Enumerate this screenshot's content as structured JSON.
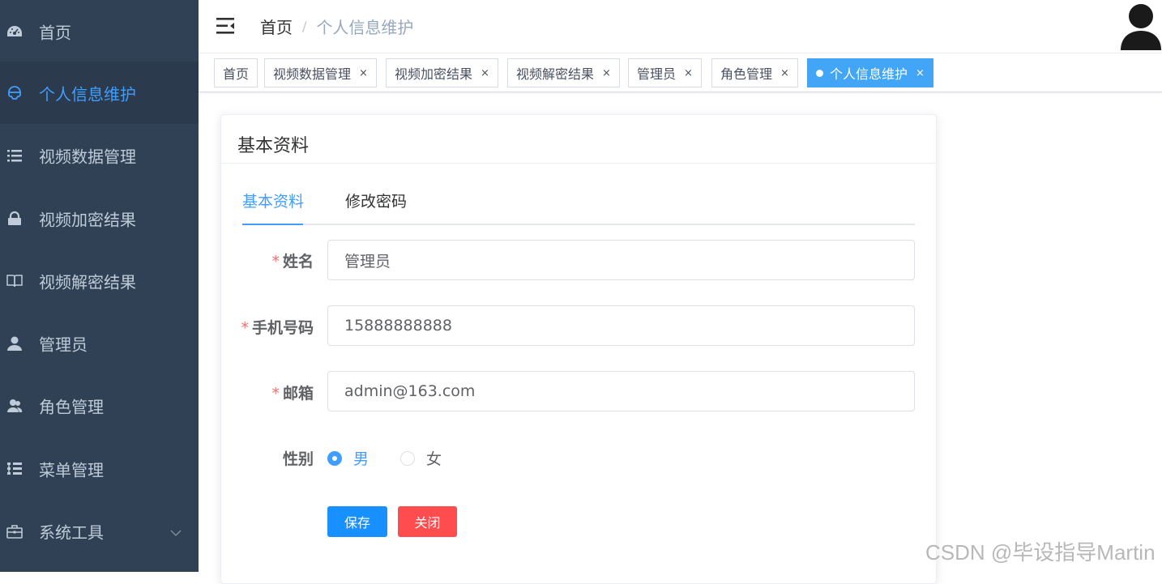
{
  "sidebar": {
    "items": [
      {
        "label": "首页",
        "icon": "dashboard-icon"
      },
      {
        "label": "个人信息维护",
        "icon": "user-profile-icon",
        "active": true
      },
      {
        "label": "视频数据管理",
        "icon": "list-icon"
      },
      {
        "label": "视频加密结果",
        "icon": "lock-icon"
      },
      {
        "label": "视频解密结果",
        "icon": "book-icon"
      },
      {
        "label": "管理员",
        "icon": "user-icon"
      },
      {
        "label": "角色管理",
        "icon": "peoples-icon"
      },
      {
        "label": "菜单管理",
        "icon": "tree-table-icon"
      },
      {
        "label": "系统工具",
        "icon": "toolbox-icon",
        "expandable": true
      }
    ]
  },
  "navbar": {
    "breadcrumb_home": "首页",
    "breadcrumb_separator": "/",
    "breadcrumb_current": "个人信息维护"
  },
  "tags": [
    {
      "label": "首页",
      "closable": false
    },
    {
      "label": "视频数据管理",
      "closable": true
    },
    {
      "label": "视频加密结果",
      "closable": true
    },
    {
      "label": "视频解密结果",
      "closable": true
    },
    {
      "label": "管理员",
      "closable": true
    },
    {
      "label": "角色管理",
      "closable": true
    },
    {
      "label": "个人信息维护",
      "closable": true,
      "active": true
    }
  ],
  "tag_close_glyph": "×",
  "card": {
    "title": "基本资料",
    "tabs": [
      {
        "label": "基本资料",
        "active": true
      },
      {
        "label": "修改密码",
        "active": false
      }
    ]
  },
  "form": {
    "required_mark": "*",
    "name_label": "姓名",
    "name_value": "管理员",
    "phone_label": "手机号码",
    "phone_value": "15888888888",
    "email_label": "邮箱",
    "email_value": "admin@163.com",
    "gender_label": "性别",
    "gender_options": [
      {
        "label": "男",
        "checked": true
      },
      {
        "label": "女",
        "checked": false
      }
    ],
    "save_label": "保存",
    "close_label": "关闭"
  },
  "watermark": "CSDN @毕设指导Martin",
  "colors": {
    "sidebar_bg": "#304156",
    "sidebar_text": "#bfcbd9",
    "accent": "#409eff",
    "active_tag": "#42a5f5",
    "primary_button": "#1890ff",
    "danger_button": "#ff4d4f",
    "required": "#f56c6c"
  }
}
